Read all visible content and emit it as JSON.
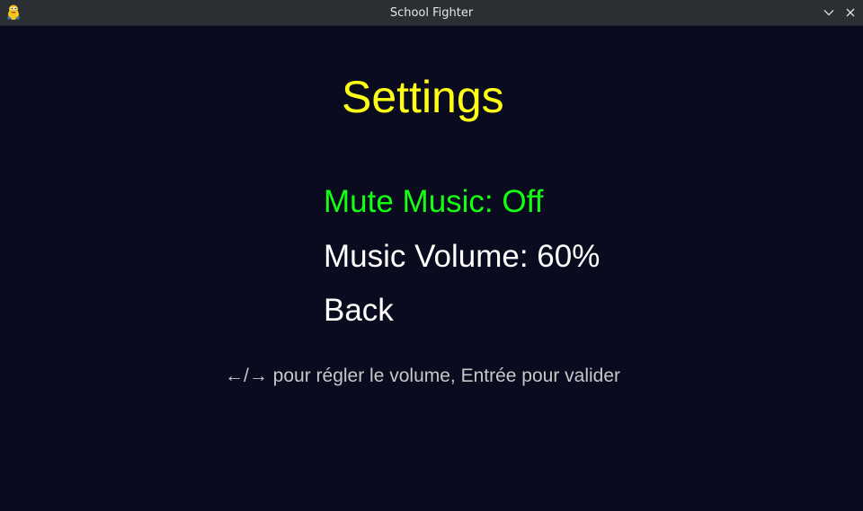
{
  "window": {
    "title": "School Fighter",
    "app_icon": "python-snake-icon",
    "controls": {
      "minimize_icon": "chevron-down-icon",
      "close_icon": "close-icon"
    }
  },
  "screen": {
    "title": "Settings",
    "menu": [
      {
        "label": "Mute Music: Off",
        "selected": true
      },
      {
        "label": "Music Volume: 60%",
        "selected": false
      },
      {
        "label": "Back",
        "selected": false
      }
    ],
    "hint": "←/→ pour régler le volume, Entrée pour valider"
  },
  "colors": {
    "background": "#0a0b1e",
    "title": "#ffff14",
    "selected": "#14ff14",
    "normal": "#ffffff",
    "hint": "#c8c8c8",
    "titlebar": "#2b2e33"
  }
}
